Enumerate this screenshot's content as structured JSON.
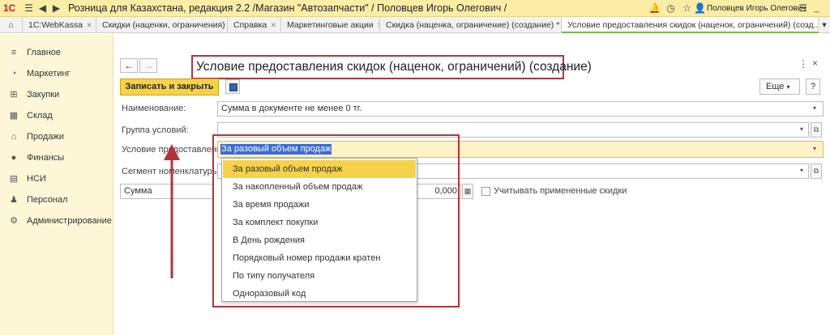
{
  "window": {
    "logo": "1С",
    "title": "Розница для Казахстана, редакция 2.2 /Магазин \"Автозапчасти\" / Половцев Игорь Олегович /",
    "user": "Половцев Игорь Олегович"
  },
  "tabs": [
    {
      "label": "1C:WebKassa",
      "close": "×",
      "active": false
    },
    {
      "label": "Скидки (наценки, ограничения)",
      "close": "×",
      "active": false
    },
    {
      "label": "Справка",
      "close": "×",
      "active": false
    },
    {
      "label": "Маркетинговые акции",
      "close": "×",
      "active": false
    },
    {
      "label": "Скидка (наценка, ограничение) (создание) *",
      "close": "×",
      "active": false
    },
    {
      "label": "Условие предоставления скидок (наценок, ограничений) (созд...",
      "close": "×",
      "active": true
    }
  ],
  "sidebar": {
    "items": [
      {
        "label": "Главное",
        "icon": "menu-icon"
      },
      {
        "label": "Маркетинг",
        "icon": "chart-icon"
      },
      {
        "label": "Закупки",
        "icon": "purchases-icon"
      },
      {
        "label": "Склад",
        "icon": "warehouse-icon"
      },
      {
        "label": "Продажи",
        "icon": "sales-icon"
      },
      {
        "label": "Финансы",
        "icon": "finance-icon"
      },
      {
        "label": "НСИ",
        "icon": "reference-icon"
      },
      {
        "label": "Персонал",
        "icon": "person-icon"
      },
      {
        "label": "Администрирование",
        "icon": "gear-icon"
      }
    ]
  },
  "form": {
    "title": "Условие предоставления скидок (наценок, ограничений) (создание)",
    "save_close": "Записать и закрыть",
    "more": "Еще",
    "help": "?",
    "fields": {
      "name_label": "Наименование:",
      "name_value": "Сумма в документе не менее 0 тг.",
      "group_label": "Группа условий:",
      "group_value": "",
      "condition_label": "Условие предоставления:",
      "condition_value": "За разовый объем продаж",
      "segment_label": "Сегмент номенклатуры:",
      "segment_value": "",
      "type_value": "Сумма",
      "amount_value": "0,000",
      "consider_label": "Учитывать примененные скидки"
    },
    "dropdown": [
      "За разовый объем продаж",
      "За накопленный объем продаж",
      "За время продажи",
      "За комплект покупки",
      "В День рождения",
      "Порядковый номер продажи кратен",
      "По типу получателя",
      "Одноразовый код"
    ]
  },
  "colors": {
    "accent": "#f6d24a",
    "highlight": "#b6333a",
    "selection": "#3b6bd6"
  }
}
